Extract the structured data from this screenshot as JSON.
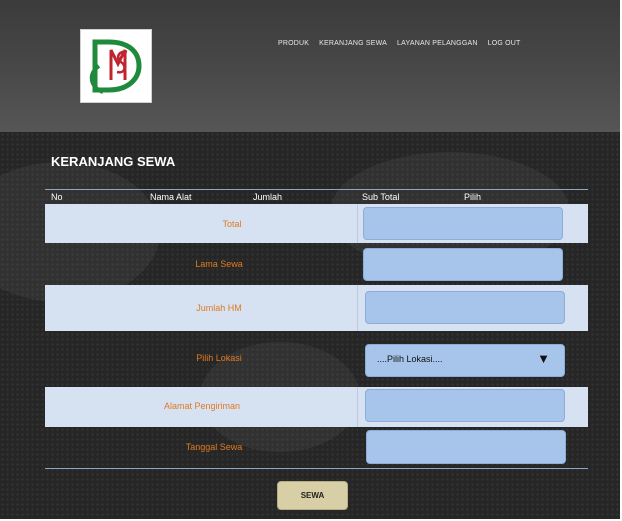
{
  "nav": {
    "items": [
      "PRODUK",
      "KERANJANG SEWA",
      "LAYANAN PELANGGAN",
      "LOG OUT"
    ]
  },
  "page": {
    "title": "KERANJANG SEWA"
  },
  "table": {
    "headers": {
      "no": "No",
      "nama_alat": "Nama Alat",
      "jumlah": "Jumlah",
      "sub_total": "Sub Total",
      "pilih": "Pilih"
    }
  },
  "form": {
    "total_label": "Total",
    "lama_sewa_label": "Lama Sewa",
    "jumlah_hm_label": "Jumlah HM",
    "pilih_lokasi_label": "Pilih Lokasi",
    "pilih_lokasi_value": "....Pilih Lokasi....",
    "alamat_label": "Alamat Pengiriman",
    "tanggal_label": "Tanggal Sewa"
  },
  "actions": {
    "submit_label": "SEWA"
  },
  "colors": {
    "label_orange": "#e07a1f",
    "field_blue": "#a7c5ea",
    "row_light": "#d6e2f2",
    "button": "#d8cfa6"
  }
}
